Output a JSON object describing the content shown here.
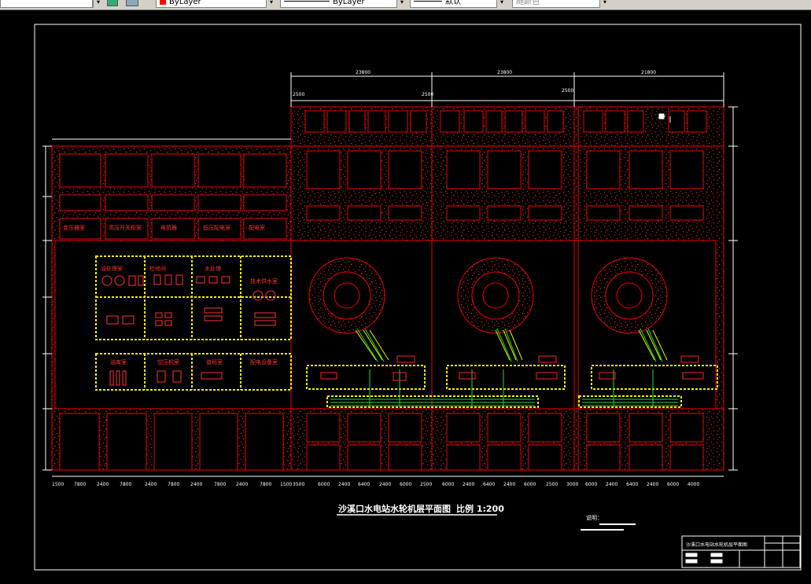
{
  "toolbar": {
    "layer_color": "ByLayer",
    "linetype": "ByLayer",
    "lineweight": "默认",
    "plotstyle": "随颜色"
  },
  "drawing": {
    "title": "沙溪口水电站水轮机层平面图",
    "scale": "比例 1:200",
    "note_label": "说明：",
    "titleblock_name": "沙溪口水电站水轮机层平面图"
  },
  "dims": {
    "top_spans": [
      "23800",
      "23800",
      "21800"
    ],
    "top_sub": [
      "2500",
      "2500",
      "2500"
    ],
    "left_top": [
      "1000",
      "5800",
      "1000",
      "5800",
      "1000",
      "5800",
      "1000",
      "5800",
      "3600",
      "1000"
    ],
    "bottom": [
      "1500",
      "7800",
      "2400",
      "7800",
      "2400",
      "7800",
      "2400",
      "7800",
      "2400",
      "7800",
      "1500",
      "3500",
      "6000",
      "2400",
      "6400",
      "2400",
      "6000",
      "2500",
      "6000",
      "2400",
      "6400",
      "2400",
      "6000",
      "2500",
      "3000",
      "6000",
      "2400",
      "6400",
      "2400",
      "6000",
      "4000"
    ],
    "right": [
      "5500",
      "1000",
      "1000",
      "5800",
      "1000",
      "2500",
      "13400",
      "2500",
      "5800",
      "1000",
      "2500",
      "5100"
    ]
  },
  "rooms": [
    "变压器室",
    "高压开关柜室",
    "电抗器",
    "低压配电室",
    "配电室",
    "油处理室",
    "检修间",
    "水处理",
    "技术供水室",
    "油库室",
    "空压机室",
    "值班室",
    "配电设备室"
  ]
}
